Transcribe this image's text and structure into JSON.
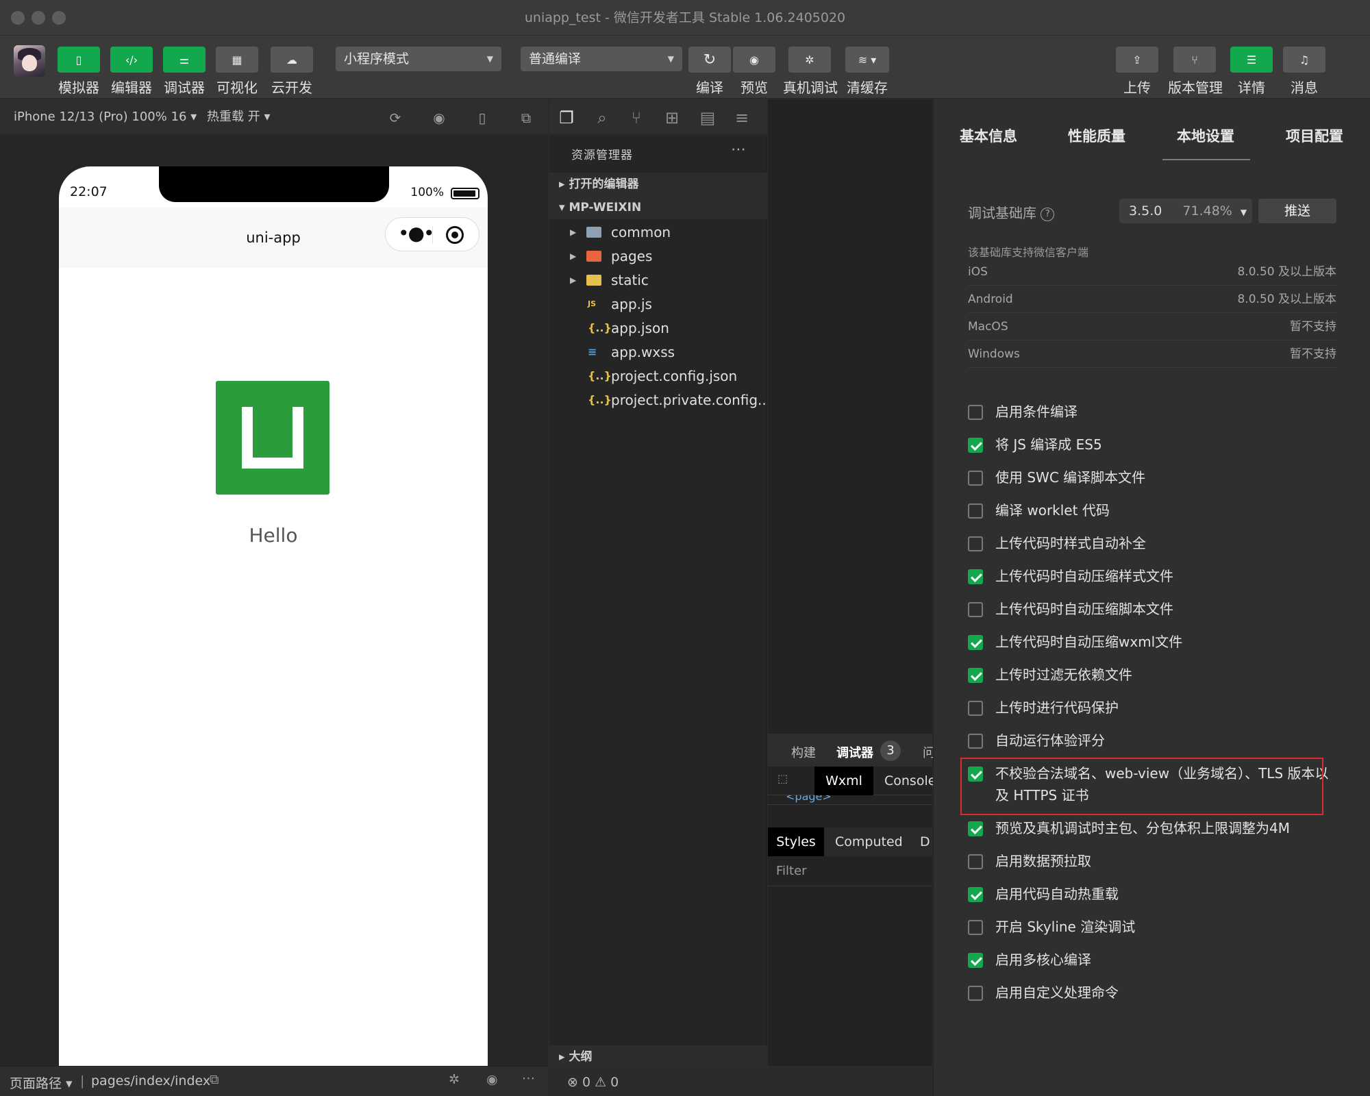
{
  "window": {
    "title": "uniapp_test - 微信开发者工具 Stable 1.06.2405020"
  },
  "toolbar": {
    "left_buttons": [
      "模拟器",
      "编辑器",
      "调试器",
      "可视化",
      "云开发"
    ],
    "mode_select": "小程序模式",
    "compile_select": "普通编译",
    "mid_buttons": [
      "编译",
      "预览",
      "真机调试",
      "清缓存"
    ],
    "right_buttons": [
      "上传",
      "版本管理",
      "详情",
      "消息"
    ]
  },
  "simulator": {
    "device": "iPhone 12/13 (Pro) 100% 16 ▾",
    "hot_reload": "热重载 开 ▾",
    "phone": {
      "time": "22:07",
      "battery": "100%",
      "nav_title": "uni-app",
      "content_text": "Hello"
    },
    "status": {
      "path_label": "页面路径 ▾",
      "path": "pages/index/index"
    }
  },
  "explorer": {
    "title": "资源管理器",
    "sections": {
      "open_editors": "打开的编辑器",
      "project": "MP-WEIXIN",
      "outline": "大纲"
    },
    "tree": [
      {
        "name": "common",
        "type": "folder",
        "color": "#8fa0b3",
        "icon": "folder-icon"
      },
      {
        "name": "pages",
        "type": "folder",
        "color": "#e8663d",
        "icon": "folder-icon"
      },
      {
        "name": "static",
        "type": "folder",
        "color": "#e5c04a",
        "icon": "folder-icon"
      },
      {
        "name": "app.js",
        "type": "file",
        "icon": "js-file-icon"
      },
      {
        "name": "app.json",
        "type": "file",
        "icon": "json-file-icon"
      },
      {
        "name": "app.wxss",
        "type": "file",
        "icon": "css-file-icon"
      },
      {
        "name": "project.config.json",
        "type": "file",
        "icon": "json-file-icon"
      },
      {
        "name": "project.private.config....",
        "type": "file",
        "icon": "json-file-icon"
      }
    ],
    "problems": "⊗ 0 ⚠ 0"
  },
  "debugger": {
    "tabs": {
      "build": "构建",
      "debugger": "调试器",
      "badge": "3",
      "more": "问"
    },
    "subtabs": {
      "wxml": "Wxml",
      "console": "Console"
    },
    "page_tag": "<page>",
    "styles_tabs": {
      "styles": "Styles",
      "computed": "Computed",
      "more": "D"
    },
    "filter": "Filter"
  },
  "settings": {
    "tabs": [
      "基本信息",
      "性能质量",
      "本地设置",
      "项目配置"
    ],
    "active_tab": "本地设置",
    "lib_label": "调试基础库",
    "lib_version": "3.5.0",
    "lib_percent": "71.48%",
    "push_label": "推送",
    "support_note": "该基础库支持微信客户端",
    "os_rows": [
      {
        "os": "iOS",
        "value": "8.0.50 及以上版本"
      },
      {
        "os": "Android",
        "value": "8.0.50 及以上版本"
      },
      {
        "os": "MacOS",
        "value": "暂不支持"
      },
      {
        "os": "Windows",
        "value": "暂不支持"
      }
    ],
    "options": [
      {
        "label": "启用条件编译",
        "checked": false
      },
      {
        "label": "将 JS 编译成 ES5",
        "checked": true
      },
      {
        "label": "使用 SWC 编译脚本文件",
        "checked": false
      },
      {
        "label": "编译 worklet 代码",
        "checked": false
      },
      {
        "label": "上传代码时样式自动补全",
        "checked": false
      },
      {
        "label": "上传代码时自动压缩样式文件",
        "checked": true
      },
      {
        "label": "上传代码时自动压缩脚本文件",
        "checked": false
      },
      {
        "label": "上传代码时自动压缩wxml文件",
        "checked": true
      },
      {
        "label": "上传时过滤无依赖文件",
        "checked": true
      },
      {
        "label": "上传时进行代码保护",
        "checked": false
      },
      {
        "label": "自动运行体验评分",
        "checked": false
      },
      {
        "label": "不校验合法域名、web-view（业务域名）、TLS 版本以及 HTTPS 证书",
        "checked": true,
        "highlighted": true
      },
      {
        "label": "预览及真机调试时主包、分包体积上限调整为4M",
        "checked": true
      },
      {
        "label": "启用数据预拉取",
        "checked": false
      },
      {
        "label": "启用代码自动热重载",
        "checked": true
      },
      {
        "label": "开启 Skyline 渲染调试",
        "checked": false
      },
      {
        "label": "启用多核心编译",
        "checked": true
      },
      {
        "label": "启用自定义处理命令",
        "checked": false
      }
    ]
  },
  "colors": {
    "accent": "#13a84e",
    "highlight": "#e0282e"
  }
}
